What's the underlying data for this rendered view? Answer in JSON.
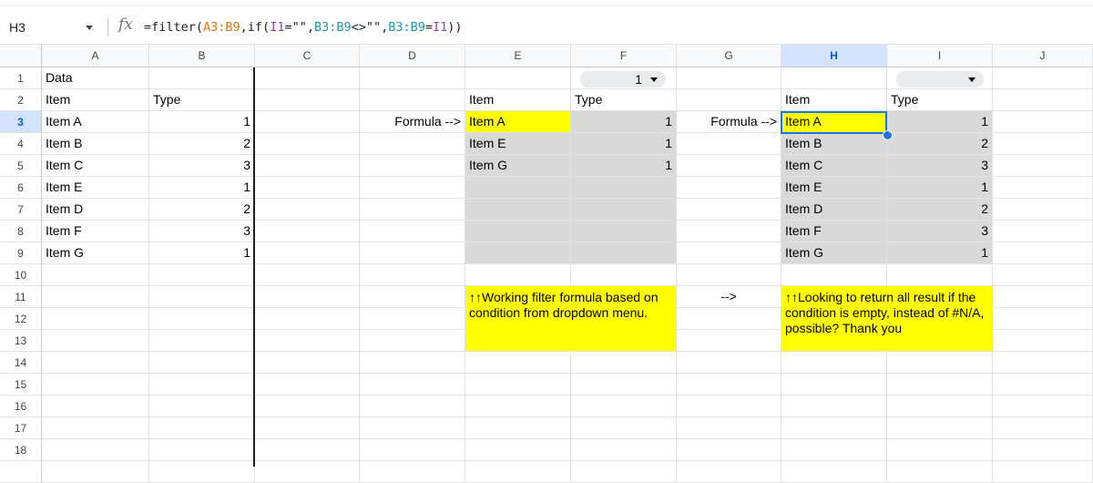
{
  "formula_bar": {
    "cell_ref": "H3",
    "fx": "fx",
    "formula_parts": {
      "p1": "=filter(",
      "p2": "A3:B9",
      "p3": ",if(",
      "p4": "I1",
      "p5": "=\"\",",
      "p6": "B3:B9",
      "p7": "<>\"\",",
      "p8": "B3:B9",
      "p9": "=",
      "p10": "I1",
      "p11": "))"
    }
  },
  "columns": [
    "A",
    "B",
    "C",
    "D",
    "E",
    "F",
    "G",
    "H",
    "I",
    "J"
  ],
  "rows": [
    "1",
    "2",
    "3",
    "4",
    "5",
    "6",
    "7",
    "8",
    "9",
    "10",
    "11",
    "12",
    "13",
    "14",
    "15",
    "16",
    "17",
    "18"
  ],
  "cells": {
    "A1": "Data",
    "A2": "Item",
    "B2": "Type",
    "A3": "Item A",
    "B3": "1",
    "A4": "Item B",
    "B4": "2",
    "A5": "Item C",
    "B5": "3",
    "A6": "Item E",
    "B6": "1",
    "A7": "Item D",
    "B7": "2",
    "A8": "Item F",
    "B8": "3",
    "A9": "Item G",
    "B9": "1",
    "F1_dropdown": "1",
    "E2": "Item",
    "F2": "Type",
    "D3": "Formula -->",
    "E3": "Item A",
    "F3": "1",
    "E4": "Item E",
    "F4": "1",
    "E5": "Item G",
    "F5": "1",
    "I1_dropdown": "",
    "H2": "Item",
    "I2": "Type",
    "G3": "Formula -->",
    "H3": "Item A",
    "I3": "1",
    "H4": "Item B",
    "I4": "2",
    "H5": "Item C",
    "I5": "3",
    "H6": "Item E",
    "I6": "1",
    "H7": "Item D",
    "I7": "2",
    "H8": "Item F",
    "I8": "3",
    "H9": "Item G",
    "I9": "1",
    "G11": "-->"
  },
  "notes": {
    "left": "↑↑Working filter formula based on condition from dropdown menu.",
    "right": "↑↑Looking to return all result if the condition is empty, instead of #N/A, possible? Thank you"
  },
  "colors": {
    "highlight": "#ffff00",
    "output_fill": "#d9d9d9",
    "selection": "#1a73e8"
  }
}
